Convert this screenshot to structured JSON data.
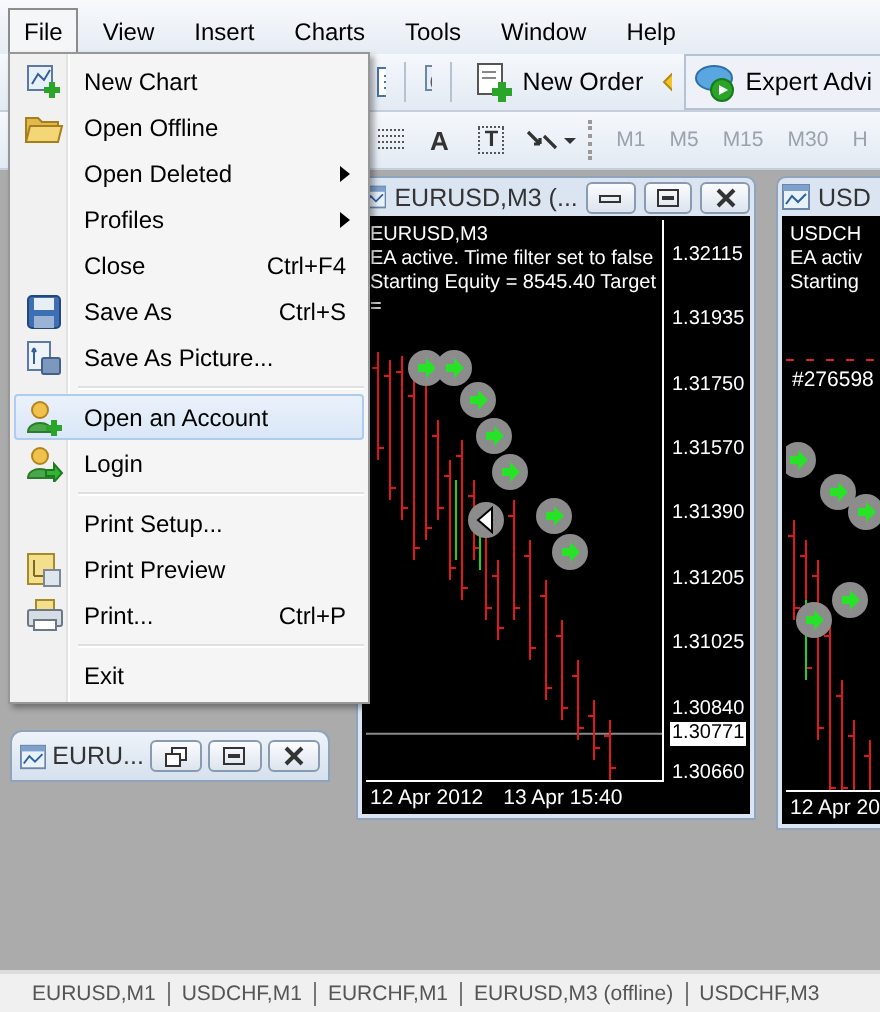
{
  "menu_bar": [
    {
      "label": "File",
      "selected": true
    },
    {
      "label": "View",
      "selected": false
    },
    {
      "label": "Insert",
      "selected": false
    },
    {
      "label": "Charts",
      "selected": false
    },
    {
      "label": "Tools",
      "selected": false
    },
    {
      "label": "Window",
      "selected": false
    },
    {
      "label": "Help",
      "selected": false
    }
  ],
  "toolbar": {
    "new_order": "New Order",
    "expert_advisors": "Expert Advi",
    "text_tool": "A",
    "text_label_tool": "T",
    "timeframes": [
      "M1",
      "M5",
      "M15",
      "M30",
      "H"
    ]
  },
  "file_menu": [
    {
      "kind": "item",
      "label": "New Chart",
      "selected": false
    },
    {
      "kind": "item",
      "label": "Open Offline",
      "selected": false
    },
    {
      "kind": "submenu",
      "label": "Open Deleted",
      "selected": false
    },
    {
      "kind": "submenu",
      "label": "Profiles",
      "selected": false
    },
    {
      "kind": "item",
      "label": "Close",
      "shortcut": "Ctrl+F4",
      "selected": false
    },
    {
      "kind": "item",
      "label": "Save As",
      "shortcut": "Ctrl+S",
      "selected": false
    },
    {
      "kind": "item",
      "label": "Save As Picture...",
      "selected": false
    },
    {
      "kind": "separator"
    },
    {
      "kind": "item",
      "label": "Open an Account",
      "selected": true
    },
    {
      "kind": "item",
      "label": "Login",
      "selected": false
    },
    {
      "kind": "separator"
    },
    {
      "kind": "item",
      "label": "Print Setup...",
      "selected": false
    },
    {
      "kind": "item",
      "label": "Print Preview",
      "selected": false
    },
    {
      "kind": "item",
      "label": "Print...",
      "shortcut": "Ctrl+P",
      "selected": false
    },
    {
      "kind": "separator"
    },
    {
      "kind": "item",
      "label": "Exit",
      "selected": false
    }
  ],
  "chart_windows": [
    {
      "title": "EURUSD,M3 (...",
      "overlay_lines": [
        "EURUSD,M3",
        "EA active. Time filter set to false",
        "Starting Equity = 8545.40 Target ="
      ],
      "price_axis": [
        "1.32115",
        "1.31935",
        "1.31750",
        "1.31570",
        "1.31390",
        "1.31205",
        "1.31025",
        "1.30840",
        "1.30660"
      ],
      "current_price": "1.30771",
      "time_axis": [
        "12 Apr 2012",
        "13 Apr 15:40"
      ]
    },
    {
      "title": "USD",
      "overlay_lines": [
        "USDCH",
        "EA activ",
        "Starting"
      ],
      "trade_label": "#276598",
      "time_axis": [
        "12 Apr 20"
      ]
    }
  ],
  "minimized_window": {
    "title": "EURU..."
  },
  "status_tabs": [
    "EURUSD,M1",
    "USDCHF,M1",
    "EURCHF,M1",
    "EURUSD,M3 (offline)",
    "USDCHF,M3"
  ]
}
